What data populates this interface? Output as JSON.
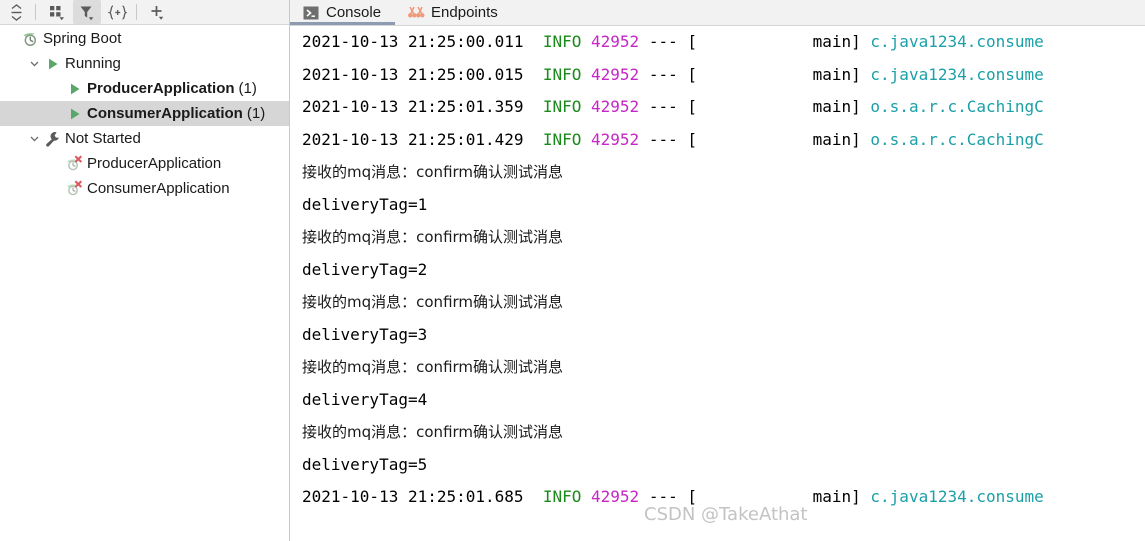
{
  "colors": {
    "info": "#1a8a1a",
    "pid": "#c526c5",
    "classname": "#1ba0a8",
    "plain": "#000000",
    "selection": "#d6d6d6",
    "tab_active_underline": "#8d9bb0",
    "toolbar_bg": "#f2f2f2",
    "run_green": "#59a869",
    "error_red": "#db5860",
    "endpoints_orange": "#ef9a7a"
  },
  "left_toolbar": {
    "buttons": [
      {
        "name": "expand-collapse-icon",
        "tooltip": "Expand/Collapse",
        "active": false
      },
      {
        "name": "group-by-icon",
        "tooltip": "Group by",
        "active": false
      },
      {
        "name": "filter-icon",
        "tooltip": "Filter",
        "active": true
      },
      {
        "name": "manage-targets-icon",
        "tooltip": "Manage Targets",
        "active": false
      },
      {
        "name": "add-icon",
        "tooltip": "Add",
        "active": false
      }
    ]
  },
  "tree": {
    "rows": [
      {
        "label": "Spring Boot",
        "count": "",
        "indent": 0,
        "twisty": "",
        "icon": "spring-boot-icon",
        "bold": false,
        "selected": false
      },
      {
        "label": "Running",
        "count": "",
        "indent": 1,
        "twisty": "v",
        "icon": "run-green-icon",
        "bold": false,
        "selected": false
      },
      {
        "label": "ProducerApplication",
        "count": "(1)",
        "indent": 2,
        "twisty": "",
        "icon": "run-green-icon",
        "bold": true,
        "selected": false
      },
      {
        "label": "ConsumerApplication",
        "count": "(1)",
        "indent": 2,
        "twisty": "",
        "icon": "run-green-icon",
        "bold": true,
        "selected": true
      },
      {
        "label": "Not Started",
        "count": "",
        "indent": 1,
        "twisty": "v",
        "icon": "wrench-icon",
        "bold": false,
        "selected": false
      },
      {
        "label": "ProducerApplication",
        "count": "",
        "indent": 2,
        "twisty": "",
        "icon": "spring-boot-error-icon",
        "bold": false,
        "selected": false
      },
      {
        "label": "ConsumerApplication",
        "count": "",
        "indent": 2,
        "twisty": "",
        "icon": "spring-boot-error-icon",
        "bold": false,
        "selected": false
      }
    ]
  },
  "tabs": [
    {
      "label": "Console",
      "icon": "console-icon",
      "active": true
    },
    {
      "label": "Endpoints",
      "icon": "endpoints-icon",
      "active": false
    }
  ],
  "console": {
    "lines": [
      {
        "type": "log",
        "timestamp": "2021-10-13 21:25:00.011",
        "level": "INFO",
        "pid": "42952",
        "sep": "---",
        "bracket_open": "[",
        "thread": "main]",
        "logger": "c.java1234.consume"
      },
      {
        "type": "log",
        "timestamp": "2021-10-13 21:25:00.015",
        "level": "INFO",
        "pid": "42952",
        "sep": "---",
        "bracket_open": "[",
        "thread": "main]",
        "logger": "c.java1234.consume"
      },
      {
        "type": "log",
        "timestamp": "2021-10-13 21:25:01.359",
        "level": "INFO",
        "pid": "42952",
        "sep": "---",
        "bracket_open": "[",
        "thread": "main]",
        "logger": "o.s.a.r.c.CachingC"
      },
      {
        "type": "log",
        "timestamp": "2021-10-13 21:25:01.429",
        "level": "INFO",
        "pid": "42952",
        "sep": "---",
        "bracket_open": "[",
        "thread": "main]",
        "logger": "o.s.a.r.c.CachingC"
      },
      {
        "type": "msg",
        "text": "接收的mq消息：confirm确认测试消息"
      },
      {
        "type": "plain",
        "text": "deliveryTag=1"
      },
      {
        "type": "msg",
        "text": "接收的mq消息：confirm确认测试消息"
      },
      {
        "type": "plain",
        "text": "deliveryTag=2"
      },
      {
        "type": "msg",
        "text": "接收的mq消息：confirm确认测试消息"
      },
      {
        "type": "plain",
        "text": "deliveryTag=3"
      },
      {
        "type": "msg",
        "text": "接收的mq消息：confirm确认测试消息"
      },
      {
        "type": "plain",
        "text": "deliveryTag=4"
      },
      {
        "type": "msg",
        "text": "接收的mq消息：confirm确认测试消息"
      },
      {
        "type": "plain",
        "text": "deliveryTag=5"
      },
      {
        "type": "log",
        "timestamp": "2021-10-13 21:25:01.685",
        "level": "INFO",
        "pid": "42952",
        "sep": "---",
        "bracket_open": "[",
        "thread": "main]",
        "logger": "c.java1234.consume"
      }
    ]
  },
  "watermark": {
    "text": "CSDN @TakeAthat"
  }
}
